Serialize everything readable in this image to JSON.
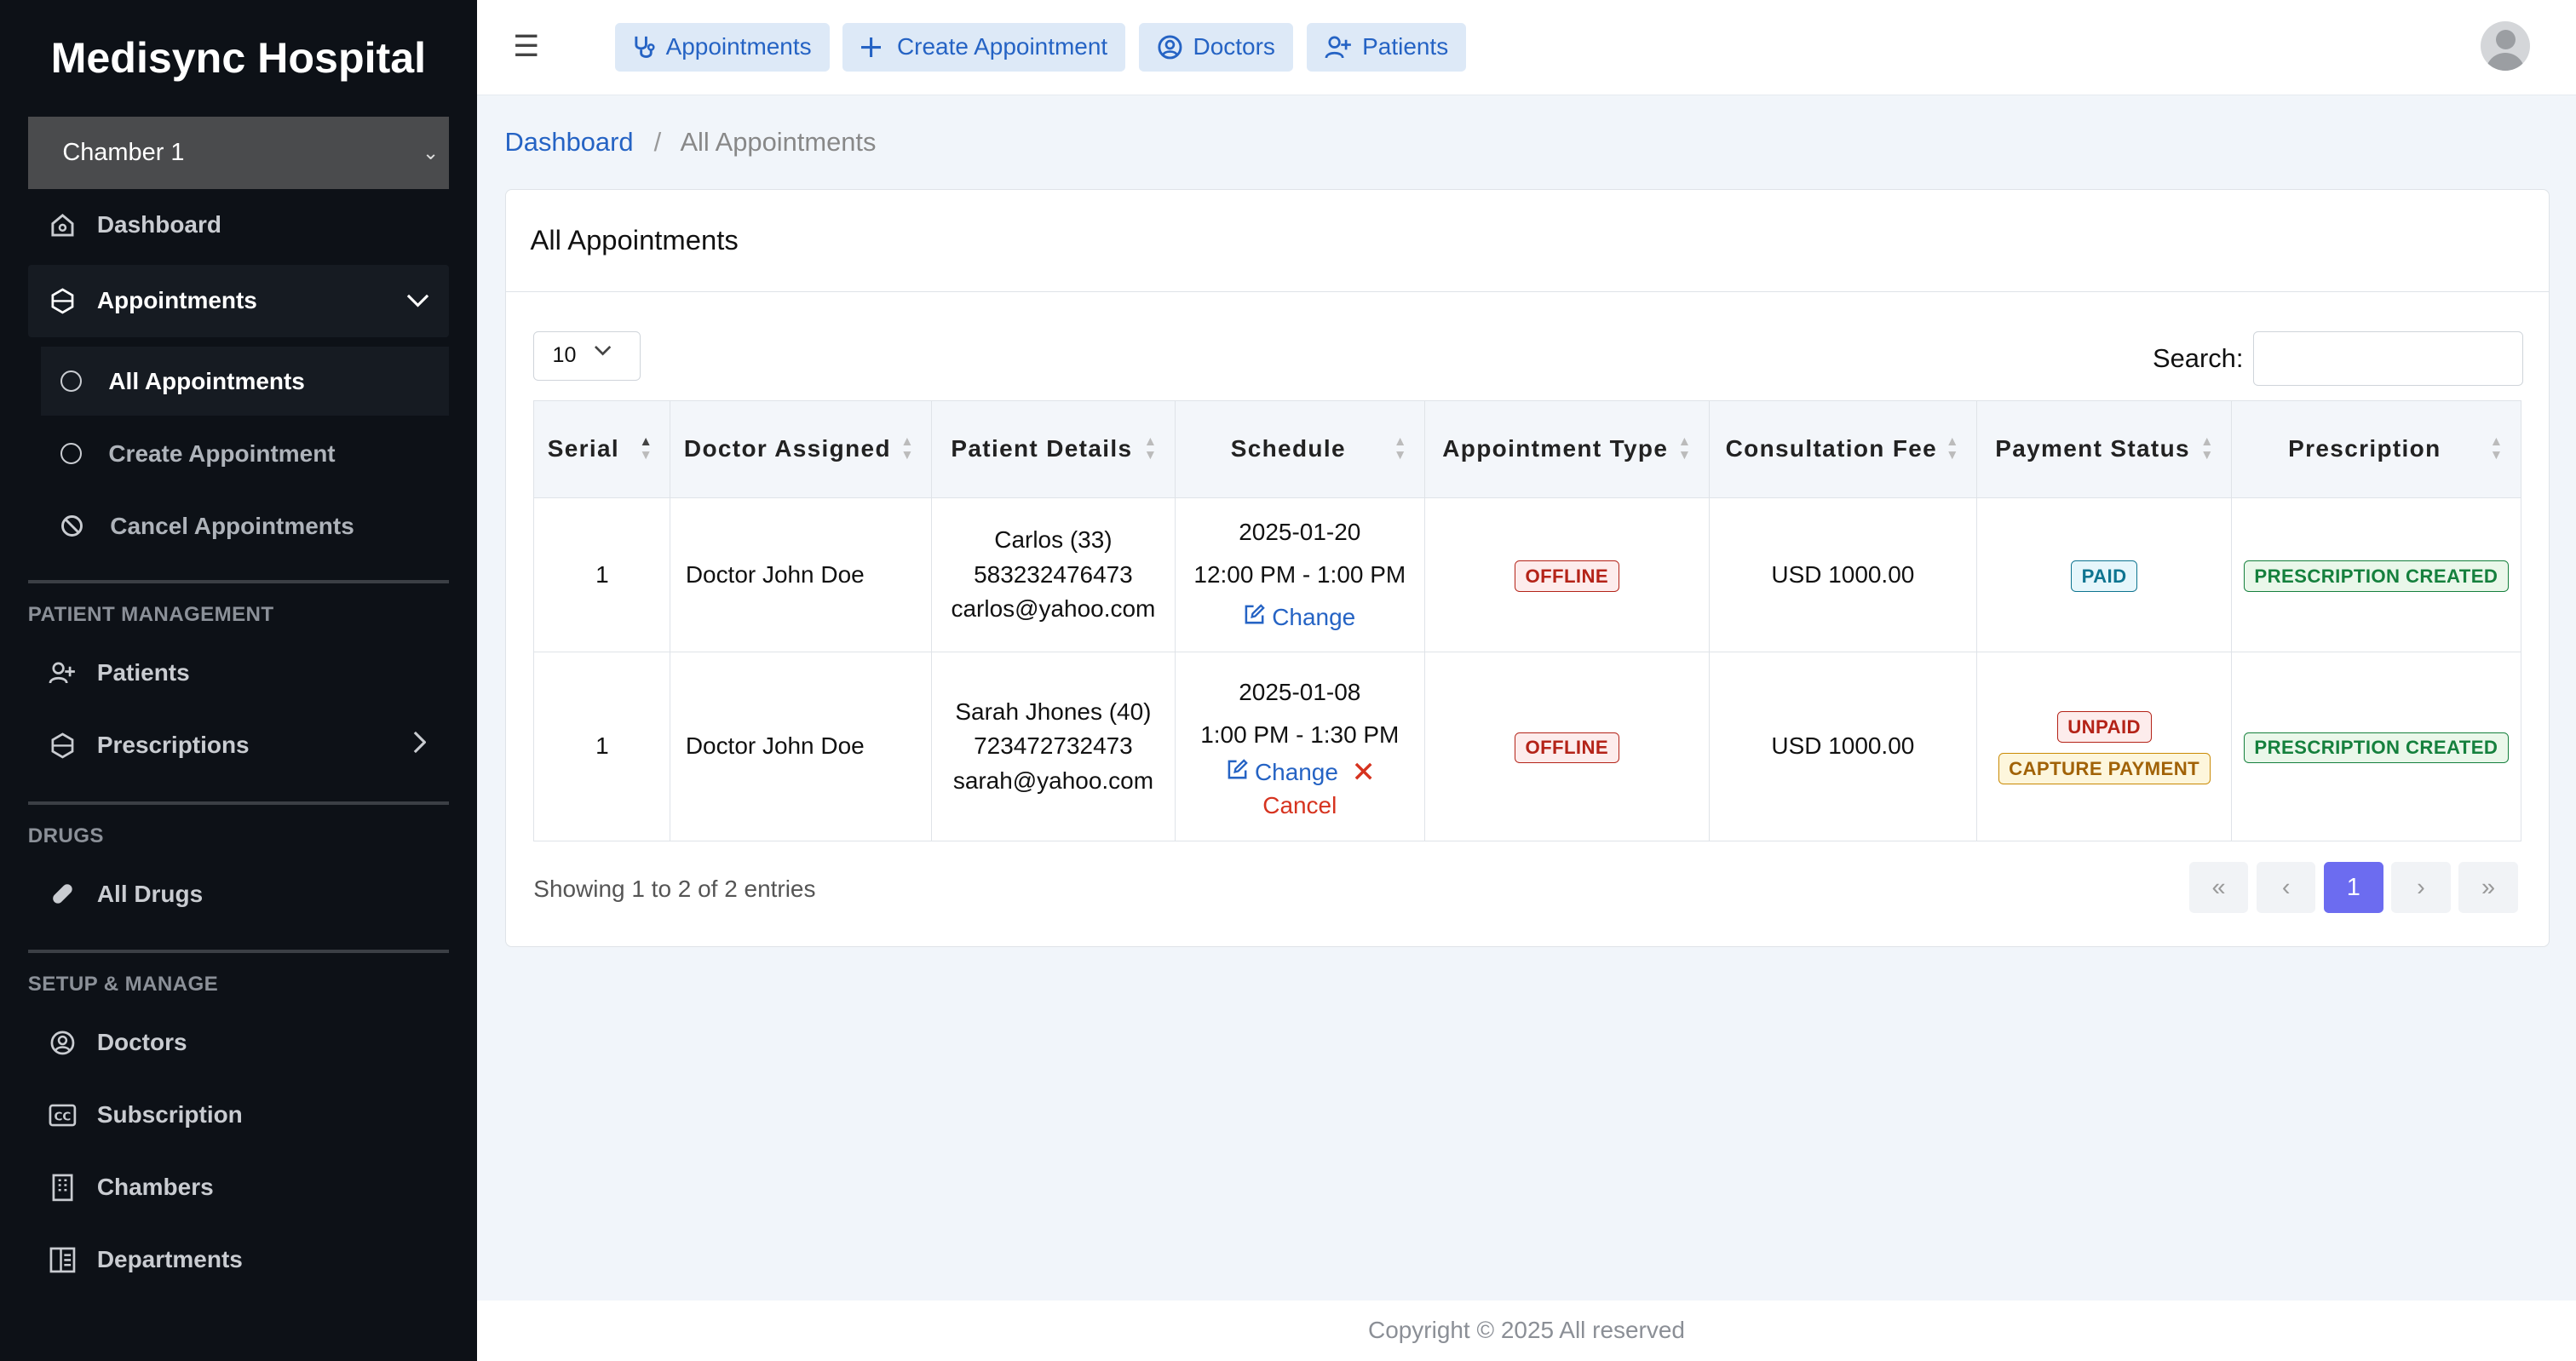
{
  "sidebar": {
    "brand": "Medisync Hospital",
    "chamber": "Chamber 1",
    "items": {
      "dashboard": "Dashboard",
      "appointments": "Appointments",
      "all_appointments": "All Appointments",
      "create_appointment": "Create Appointment",
      "cancel_appointments": "Cancel Appointments",
      "patients": "Patients",
      "prescriptions": "Prescriptions",
      "all_drugs": "All Drugs",
      "doctors": "Doctors",
      "subscription": "Subscription",
      "chambers": "Chambers",
      "departments": "Departments"
    },
    "sections": {
      "patient_management": "PATIENT MANAGEMENT",
      "drugs": "DRUGS",
      "setup": "SETUP & MANAGE"
    }
  },
  "topbar": {
    "appointments": "Appointments",
    "create_appointment": "Create Appointment",
    "doctors": "Doctors",
    "patients": "Patients"
  },
  "breadcrumb": {
    "home": "Dashboard",
    "sep": "/",
    "current": "All Appointments"
  },
  "card": {
    "title": "All Appointments",
    "page_length": "10",
    "search_label": "Search:",
    "search_value": "",
    "info": "Showing 1 to 2 of 2 entries"
  },
  "table": {
    "headers": [
      "Serial",
      "Doctor Assigned",
      "Patient Details",
      "Schedule",
      "Appointment Type",
      "Consultation Fee",
      "Payment Status",
      "Prescription"
    ],
    "rows": [
      {
        "serial": "1",
        "doctor": "Doctor John Doe",
        "patient_name": "Carlos (33)",
        "patient_phone": "583232476473",
        "patient_email": "carlos@yahoo.com",
        "date": "2025-01-20",
        "time": "12:00 PM - 1:00 PM",
        "change": "Change",
        "type": "OFFLINE",
        "fee": "USD 1000.00",
        "payment": "PAID",
        "prescription": "PRESCRIPTION CREATED"
      },
      {
        "serial": "1",
        "doctor": "Doctor John Doe",
        "patient_name": "Sarah Jhones (40)",
        "patient_phone": "723472732473",
        "patient_email": "sarah@yahoo.com",
        "date": "2025-01-08",
        "time": "1:00 PM - 1:30 PM",
        "change": "Change",
        "cancel": "Cancel",
        "type": "OFFLINE",
        "fee": "USD 1000.00",
        "payment": "UNPAID",
        "capture": "CAPTURE PAYMENT",
        "prescription": "PRESCRIPTION CREATED"
      }
    ]
  },
  "pager": {
    "first": "«",
    "prev": "‹",
    "current": "1",
    "next": "›",
    "last": "»"
  },
  "footer": "Copyright © 2025 All reserved"
}
